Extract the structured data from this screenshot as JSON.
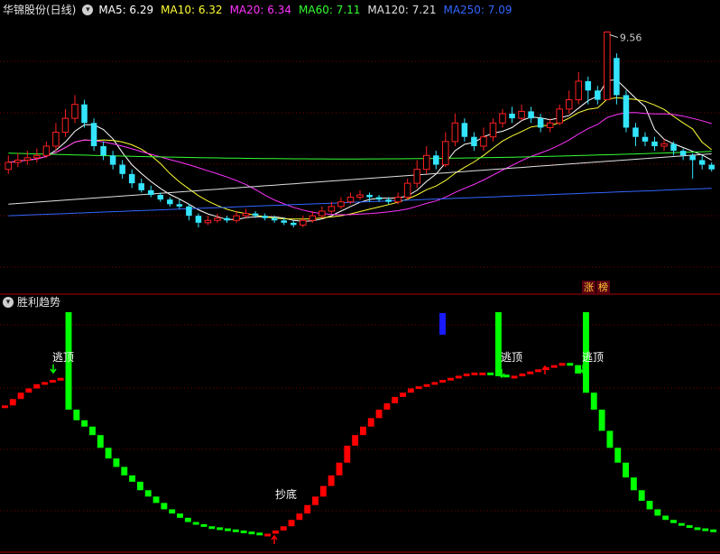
{
  "header": {
    "stock_title": "华锦股份(日线)",
    "ma": [
      {
        "label": "MA5: 6.29",
        "color": "#ffffff"
      },
      {
        "label": "MA10: 6.32",
        "color": "#ffff33"
      },
      {
        "label": "MA20: 6.34",
        "color": "#ff33ff"
      },
      {
        "label": "MA60: 7.11",
        "color": "#33ff33"
      },
      {
        "label": "MA120: 7.21",
        "color": "#e0e0e0"
      },
      {
        "label": "MA250: 7.09",
        "color": "#3366ff"
      }
    ]
  },
  "main_chart": {
    "peak_label": "9.56",
    "badges": [
      {
        "text": "涨",
        "color": "#ffcc33"
      },
      {
        "text": "榜",
        "color": "#ffcc33"
      }
    ]
  },
  "indicator": {
    "title": "胜利趋势",
    "signals": {
      "escape": "逃顶",
      "bottom": "抄底"
    }
  },
  "colors": {
    "up": "#ff2020",
    "down": "#33e5ff",
    "ind_up": "#ff0000",
    "ind_down": "#00ff00",
    "grid": "#7a0000",
    "separator": "#b00000",
    "blue_mark": "#1a1aff"
  },
  "chart_data": {
    "type": "candlestick",
    "peak_price": 9.56,
    "candles": [
      [
        6.6,
        6.75,
        6.9,
        6.5
      ],
      [
        6.75,
        6.8,
        6.95,
        6.65
      ],
      [
        6.8,
        6.85,
        7.0,
        6.7
      ],
      [
        6.85,
        6.9,
        7.05,
        6.75
      ],
      [
        6.9,
        7.1,
        7.2,
        6.85
      ],
      [
        7.1,
        7.4,
        7.6,
        7.0
      ],
      [
        7.4,
        7.7,
        7.9,
        7.3
      ],
      [
        7.7,
        8.0,
        8.2,
        7.6
      ],
      [
        8.0,
        7.6,
        8.1,
        7.5
      ],
      [
        7.6,
        7.1,
        7.7,
        7.0
      ],
      [
        7.1,
        6.9,
        7.2,
        6.8
      ],
      [
        6.9,
        6.7,
        7.0,
        6.6
      ],
      [
        6.7,
        6.5,
        6.8,
        6.4
      ],
      [
        6.5,
        6.3,
        6.6,
        6.2
      ],
      [
        6.3,
        6.15,
        6.4,
        6.1
      ],
      [
        6.15,
        6.05,
        6.25,
        6.0
      ],
      [
        6.05,
        5.95,
        6.1,
        5.9
      ],
      [
        5.95,
        5.85,
        6.0,
        5.8
      ],
      [
        5.85,
        5.8,
        5.95,
        5.75
      ],
      [
        5.8,
        5.6,
        5.85,
        5.5
      ],
      [
        5.6,
        5.45,
        5.65,
        5.35
      ],
      [
        5.45,
        5.5,
        5.6,
        5.4
      ],
      [
        5.5,
        5.55,
        5.65,
        5.45
      ],
      [
        5.55,
        5.5,
        5.6,
        5.45
      ],
      [
        5.5,
        5.6,
        5.7,
        5.45
      ],
      [
        5.6,
        5.65,
        5.75,
        5.55
      ],
      [
        5.65,
        5.6,
        5.7,
        5.55
      ],
      [
        5.6,
        5.55,
        5.65,
        5.5
      ],
      [
        5.55,
        5.5,
        5.6,
        5.45
      ],
      [
        5.5,
        5.45,
        5.55,
        5.4
      ],
      [
        5.45,
        5.4,
        5.5,
        5.35
      ],
      [
        5.4,
        5.5,
        5.6,
        5.35
      ],
      [
        5.5,
        5.6,
        5.7,
        5.45
      ],
      [
        5.6,
        5.7,
        5.8,
        5.55
      ],
      [
        5.7,
        5.8,
        5.9,
        5.65
      ],
      [
        5.8,
        5.9,
        6.0,
        5.75
      ],
      [
        5.9,
        6.0,
        6.1,
        5.85
      ],
      [
        6.0,
        6.05,
        6.15,
        5.95
      ],
      [
        6.05,
        6.0,
        6.1,
        5.9
      ],
      [
        6.0,
        5.95,
        6.05,
        5.9
      ],
      [
        5.95,
        5.9,
        6.0,
        5.85
      ],
      [
        5.9,
        6.0,
        6.1,
        5.85
      ],
      [
        6.0,
        6.3,
        6.4,
        5.95
      ],
      [
        6.3,
        6.6,
        6.8,
        6.2
      ],
      [
        6.6,
        6.9,
        7.1,
        6.5
      ],
      [
        6.9,
        6.7,
        7.0,
        6.6
      ],
      [
        6.7,
        7.2,
        7.4,
        6.65
      ],
      [
        7.2,
        7.6,
        7.8,
        7.1
      ],
      [
        7.6,
        7.3,
        7.7,
        7.2
      ],
      [
        7.3,
        7.1,
        7.4,
        7.0
      ],
      [
        7.1,
        7.3,
        7.5,
        7.0
      ],
      [
        7.3,
        7.6,
        7.7,
        7.2
      ],
      [
        7.6,
        7.8,
        7.9,
        7.5
      ],
      [
        7.8,
        7.7,
        7.95,
        7.6
      ],
      [
        7.7,
        7.85,
        8.0,
        7.65
      ],
      [
        7.85,
        7.7,
        7.95,
        7.6
      ],
      [
        7.7,
        7.5,
        7.8,
        7.4
      ],
      [
        7.5,
        7.6,
        7.7,
        7.4
      ],
      [
        7.6,
        7.9,
        8.0,
        7.55
      ],
      [
        7.9,
        8.1,
        8.3,
        7.8
      ],
      [
        8.1,
        8.5,
        8.7,
        8.0
      ],
      [
        8.5,
        8.3,
        8.6,
        8.0
      ],
      [
        8.3,
        8.1,
        8.4,
        8.0
      ],
      [
        8.1,
        9.56,
        9.56,
        8.1
      ],
      [
        9.0,
        8.2,
        9.1,
        8.0
      ],
      [
        8.2,
        7.5,
        8.3,
        7.4
      ],
      [
        7.5,
        7.3,
        7.6,
        7.1
      ],
      [
        7.3,
        7.2,
        7.4,
        7.1
      ],
      [
        7.2,
        7.1,
        7.3,
        7.0
      ],
      [
        7.1,
        7.15,
        7.25,
        7.0
      ],
      [
        7.15,
        7.0,
        7.2,
        6.9
      ],
      [
        7.0,
        6.9,
        7.05,
        6.8
      ],
      [
        6.9,
        6.8,
        6.95,
        6.4
      ],
      [
        6.8,
        6.7,
        6.9,
        6.6
      ],
      [
        6.7,
        6.6,
        6.75,
        6.55
      ]
    ],
    "indicator_values": [
      0.62,
      0.65,
      0.68,
      0.7,
      0.72,
      0.73,
      0.74,
      0.75,
      0.6,
      0.55,
      0.52,
      0.48,
      0.42,
      0.37,
      0.33,
      0.29,
      0.26,
      0.22,
      0.19,
      0.16,
      0.13,
      0.11,
      0.09,
      0.07,
      0.06,
      0.05,
      0.045,
      0.04,
      0.035,
      0.03,
      0.025,
      0.02,
      0.01,
      0.015,
      0.03,
      0.05,
      0.08,
      0.11,
      0.15,
      0.19,
      0.24,
      0.29,
      0.35,
      0.43,
      0.48,
      0.52,
      0.56,
      0.6,
      0.63,
      0.66,
      0.68,
      0.7,
      0.71,
      0.72,
      0.73,
      0.74,
      0.75,
      0.76,
      0.77,
      0.775,
      0.775,
      0.77,
      0.765,
      0.76,
      0.76,
      0.77,
      0.78,
      0.79,
      0.8,
      0.81,
      0.82,
      0.81,
      0.77,
      0.68,
      0.6,
      0.5,
      0.42,
      0.35,
      0.28,
      0.22,
      0.17,
      0.13,
      0.1,
      0.08,
      0.065,
      0.055,
      0.045,
      0.04,
      0.035,
      0.03
    ]
  }
}
